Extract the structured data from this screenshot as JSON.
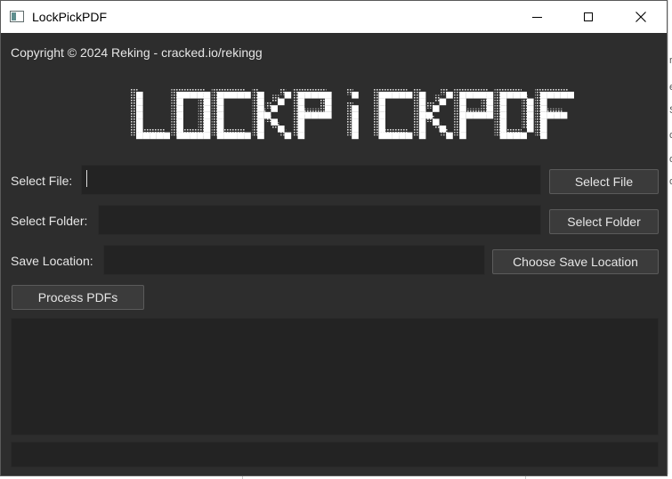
{
  "window": {
    "title": "LockPickPDF",
    "controls": {
      "minimize": "minimize",
      "maximize": "maximize",
      "close": "close"
    }
  },
  "copyright": "Copyright © 2024 Reking - cracked.io/rekingg",
  "logo": {
    "text": "LOCKPICKPDF",
    "alt": "LockPickPDF"
  },
  "form": {
    "select_file": {
      "label": "Select File:",
      "value": "",
      "button": "Select File"
    },
    "select_folder": {
      "label": "Select Folder:",
      "value": "",
      "button": "Select Folder"
    },
    "save_location": {
      "label": "Save Location:",
      "value": "",
      "button": "Choose Save Location"
    }
  },
  "process_button": "Process PDFs",
  "log": {
    "text": ""
  },
  "progress": {
    "value": 0
  },
  "colors": {
    "window_bg": "#2d2d2d",
    "field_bg": "#232323",
    "button_bg": "#3b3b3b",
    "text": "#e6e6e6"
  },
  "icons": [
    "app-icon",
    "minimize-icon",
    "maximize-icon",
    "close-icon"
  ]
}
